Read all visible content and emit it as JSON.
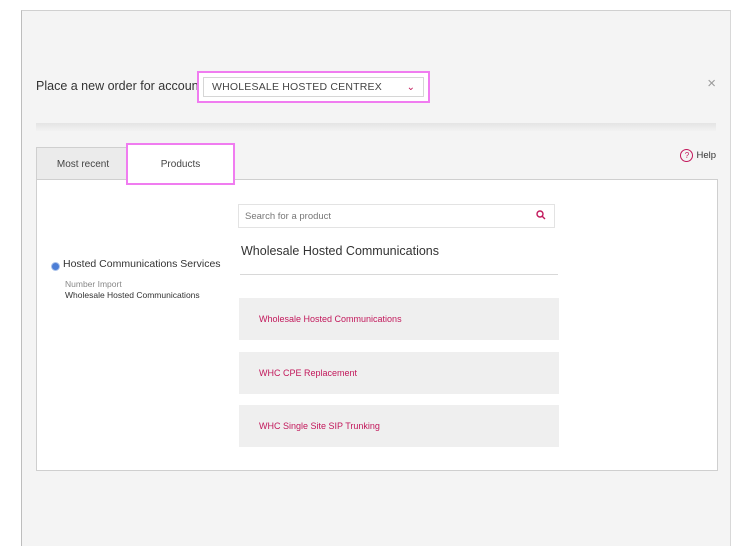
{
  "header": {
    "label": "Place a new order for account",
    "account": "WHOLESALE HOSTED CENTREX",
    "close": "×"
  },
  "help": {
    "label": "Help",
    "icon": "?"
  },
  "tabs": [
    {
      "label": "Most recent",
      "active": false
    },
    {
      "label": "Products",
      "active": true
    }
  ],
  "sidebar": {
    "category": "Hosted Communications Services",
    "subitems": [
      "Number Import",
      "Wholesale Hosted Communications"
    ]
  },
  "search": {
    "placeholder": "Search for a product"
  },
  "main": {
    "title": "Wholesale Hosted Communications",
    "products": [
      "Wholesale Hosted Communications",
      "WHC CPE Replacement",
      "WHC Single Site SIP Trunking"
    ]
  },
  "colors": {
    "accent": "#c2185b",
    "highlight": "#f07cf0",
    "radio": "#4c7ed6"
  }
}
